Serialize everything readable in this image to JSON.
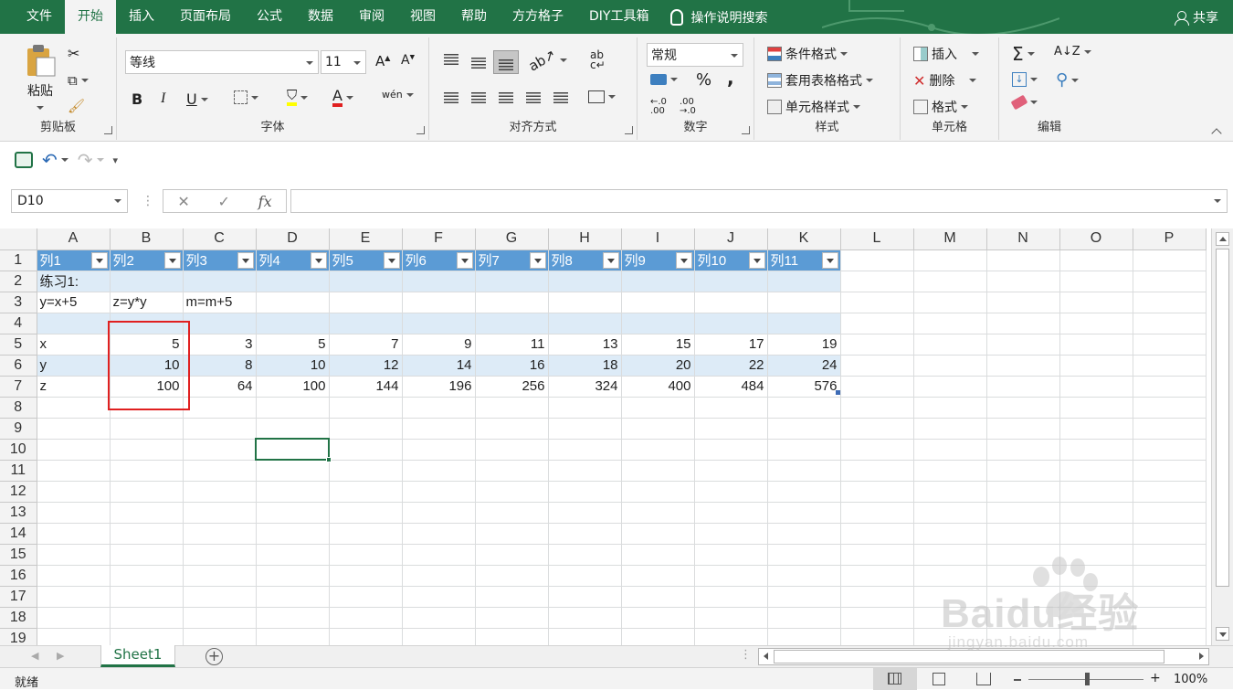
{
  "ribbon_tabs": [
    "文件",
    "开始",
    "插入",
    "页面布局",
    "公式",
    "数据",
    "审阅",
    "视图",
    "帮助",
    "方方格子",
    "DIY工具箱"
  ],
  "active_tab": "开始",
  "tell_me": "操作说明搜索",
  "share": "共享",
  "clipboard": {
    "paste": "粘贴",
    "label": "剪贴板"
  },
  "font": {
    "name": "等线",
    "size": "11",
    "label": "字体",
    "bold": "B",
    "italic": "I",
    "underline": "U",
    "phonetic": "wén"
  },
  "alignment": {
    "label": "对齐方式"
  },
  "number": {
    "format": "常规",
    "label": "数字",
    "percent": "%",
    "comma": ","
  },
  "styles": {
    "conditional": "条件格式",
    "table": "套用表格格式",
    "cell": "单元格样式",
    "label": "样式"
  },
  "cells": {
    "insert": "插入",
    "delete": "删除",
    "format": "格式",
    "label": "单元格"
  },
  "editing": {
    "label": "编辑"
  },
  "formula_bar": {
    "name_box": "D10",
    "fx": "fx",
    "formula": ""
  },
  "columns": [
    "A",
    "B",
    "C",
    "D",
    "E",
    "F",
    "G",
    "H",
    "I",
    "J",
    "K",
    "L",
    "M",
    "N",
    "O",
    "P"
  ],
  "selected_col": "D",
  "selected_row": "10",
  "table_headers": [
    "列1",
    "列2",
    "列3",
    "列4",
    "列5",
    "列6",
    "列7",
    "列8",
    "列9",
    "列10",
    "列11"
  ],
  "rows": {
    "r2": [
      "练习1:"
    ],
    "r3": [
      "y=x+5",
      "z=y*y",
      "m=m+5"
    ],
    "r5": {
      "label": "x",
      "values": [
        "5",
        "3",
        "5",
        "7",
        "9",
        "11",
        "13",
        "15",
        "17",
        "19"
      ]
    },
    "r6": {
      "label": "y",
      "values": [
        "10",
        "8",
        "10",
        "12",
        "14",
        "16",
        "18",
        "20",
        "22",
        "24"
      ]
    },
    "r7": {
      "label": "z",
      "values": [
        "100",
        "64",
        "100",
        "144",
        "196",
        "256",
        "324",
        "400",
        "484",
        "576"
      ]
    }
  },
  "row_numbers": [
    "1",
    "2",
    "3",
    "4",
    "5",
    "6",
    "7",
    "8",
    "9",
    "10",
    "11",
    "12",
    "13",
    "14",
    "15",
    "16",
    "17",
    "18",
    "19"
  ],
  "sheet_tab": "Sheet1",
  "add_sheet": "+",
  "status": {
    "ready": "就绪",
    "zoom": "100%"
  },
  "watermark": {
    "text": "Baidu经验",
    "url": "jingyan.baidu.com"
  },
  "colors": {
    "brand": "#217346",
    "table_header": "#5b9bd5",
    "band": "#ddebf7",
    "highlight": "#e02020"
  }
}
